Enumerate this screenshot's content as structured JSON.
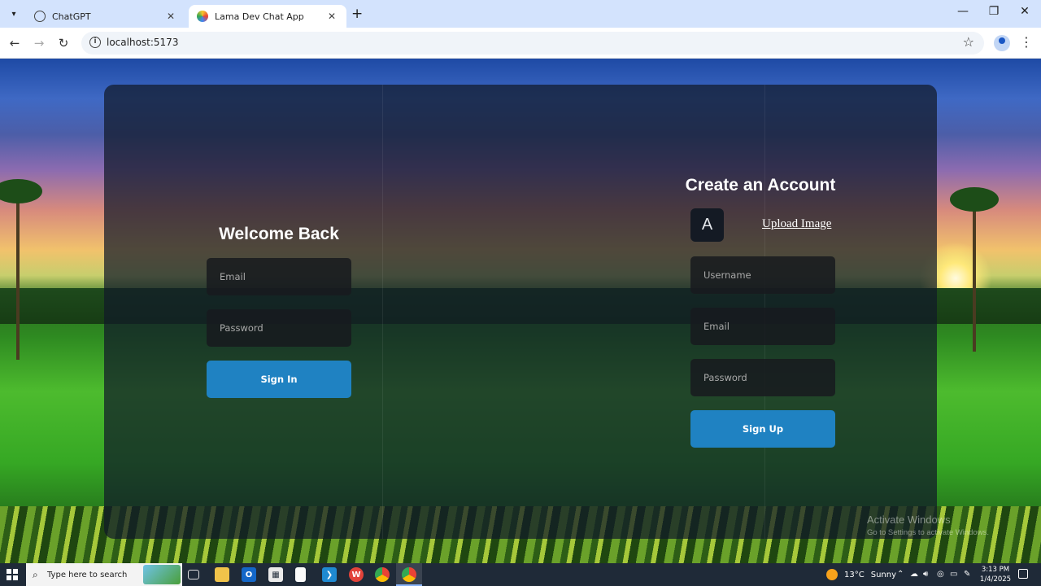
{
  "browser": {
    "tabs": [
      {
        "title": "ChatGPT",
        "active": false
      },
      {
        "title": "Lama Dev Chat App",
        "active": true
      }
    ],
    "url": "localhost:5173"
  },
  "login": {
    "heading": "Welcome Back",
    "email_placeholder": "Email",
    "password_placeholder": "Password",
    "submit_label": "Sign In"
  },
  "register": {
    "heading": "Create an Account",
    "avatar_letter": "A",
    "upload_label": "Upload Image",
    "username_placeholder": "Username",
    "email_placeholder": "Email",
    "password_placeholder": "Password",
    "submit_label": "Sign Up"
  },
  "watermark": {
    "title": "Activate Windows",
    "subtitle": "Go to Settings to activate Windows."
  },
  "taskbar": {
    "search_placeholder": "Type here to search",
    "weather_temp": "13°C",
    "weather_text": "Sunny",
    "time": "3:13 PM",
    "date": "1/4/2025"
  },
  "colors": {
    "accent": "#1f82c2",
    "card_bg": "rgba(17, 25, 40, 0.72)",
    "input_bg": "#1c1e22"
  }
}
